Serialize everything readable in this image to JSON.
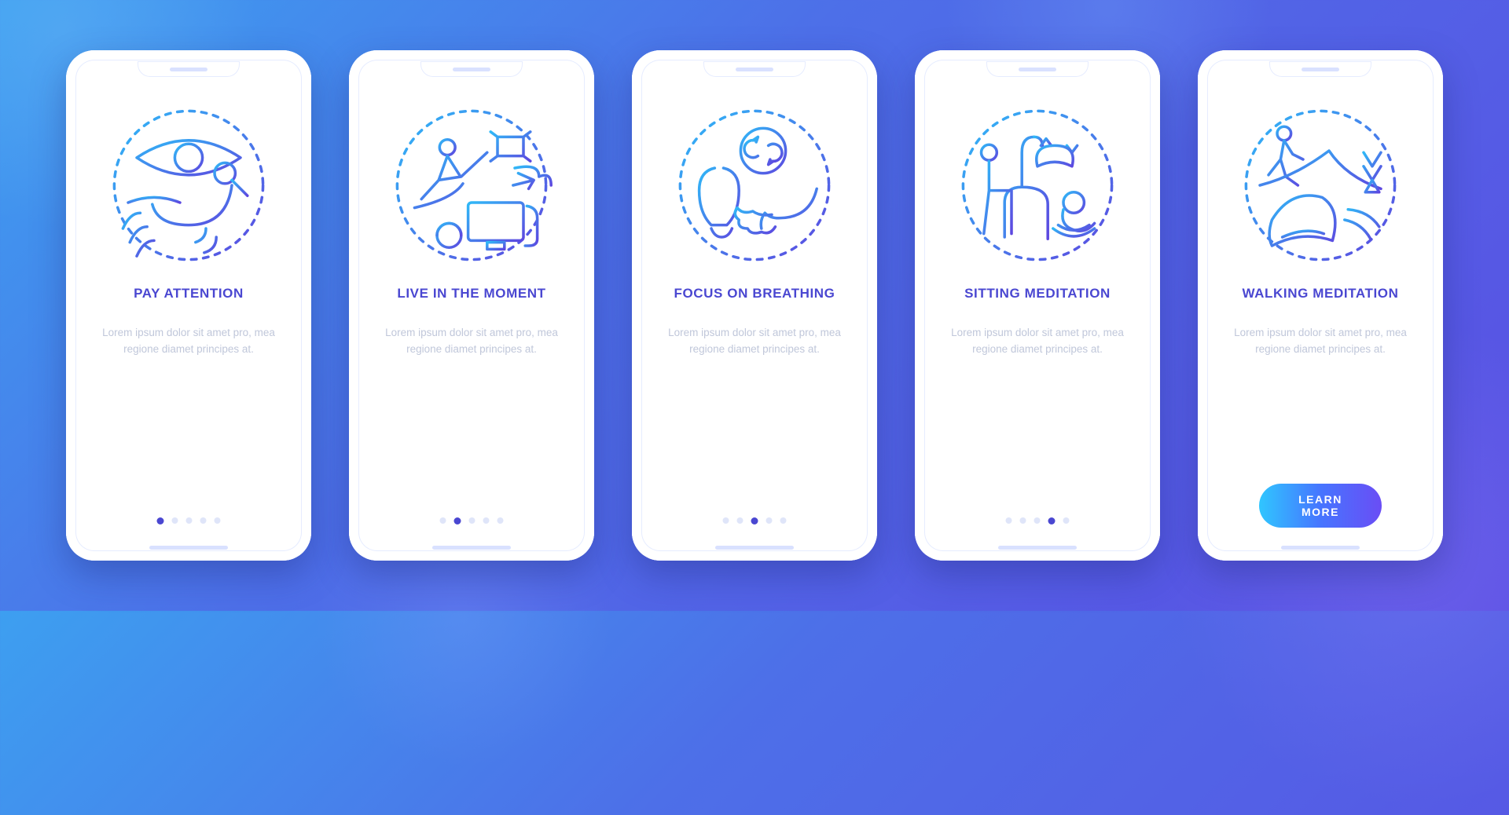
{
  "colors": {
    "brand_text": "#4a47d1",
    "desc_text": "#c0c7da",
    "grad_a": "#30c6ff",
    "grad_b": "#6a4df5"
  },
  "cta_label": "LEARN MORE",
  "slides": [
    {
      "id": "pay-attention",
      "title": "PAY ATTENTION",
      "desc": "Lorem ipsum dolor sit amet pro, mea regione diamet principes at.",
      "icon": "attention-icon",
      "active_dot": 0
    },
    {
      "id": "live-in-the-moment",
      "title": "LIVE IN THE MOMENT",
      "desc": "Lorem ipsum dolor sit amet pro, mea regione diamet principes at.",
      "icon": "moment-icon",
      "active_dot": 1
    },
    {
      "id": "focus-on-breathing",
      "title": "FOCUS ON BREATHING",
      "desc": "Lorem ipsum dolor sit amet pro, mea regione diamet principes at.",
      "icon": "breathing-icon",
      "active_dot": 2
    },
    {
      "id": "sitting-meditation",
      "title": "SITTING MEDITATION",
      "desc": "Lorem ipsum dolor sit amet pro, mea regione diamet principes at.",
      "icon": "sitting-icon",
      "active_dot": 3
    },
    {
      "id": "walking-meditation",
      "title": "WALKING MEDITATION",
      "desc": "Lorem ipsum dolor sit amet pro, mea regione diamet principes at.",
      "icon": "walking-icon",
      "active_dot": 4
    }
  ],
  "dots_per_phone": 5
}
